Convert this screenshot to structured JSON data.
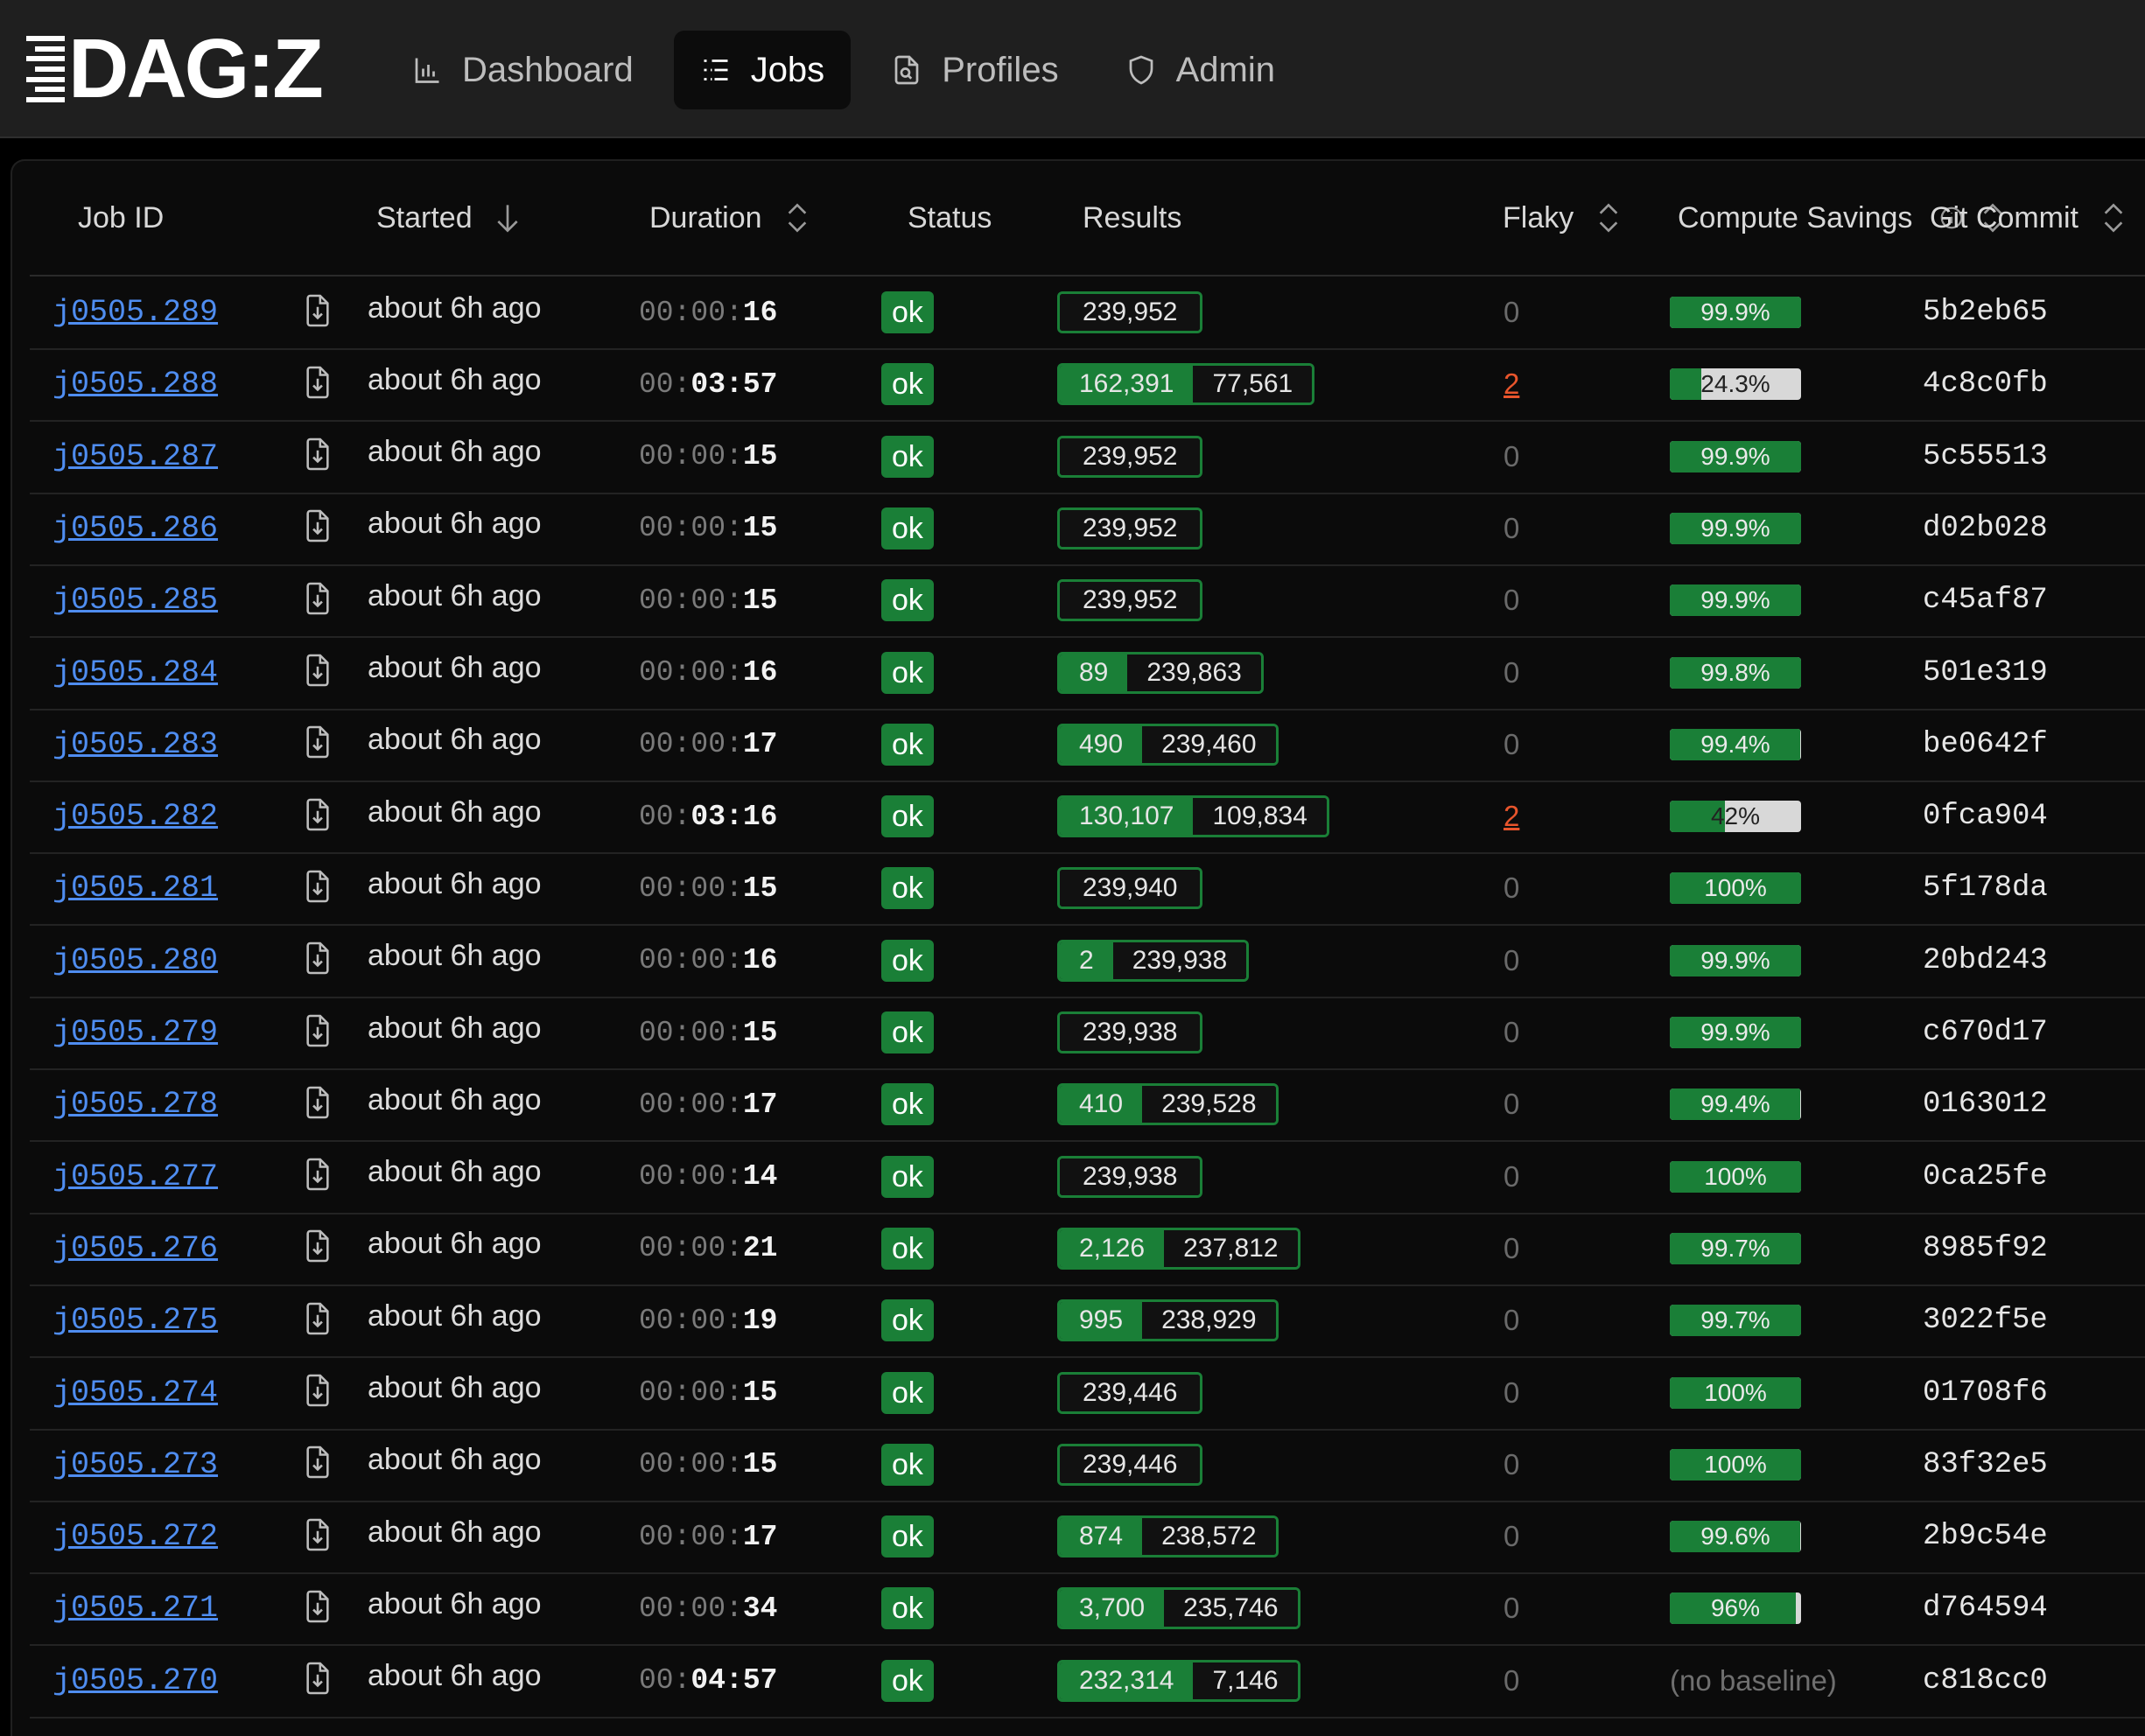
{
  "app": {
    "logo_text": "DAG:Z"
  },
  "nav": [
    {
      "label": "Dashboard",
      "icon": "bar-chart-icon",
      "active": false
    },
    {
      "label": "Jobs",
      "icon": "list-icon",
      "active": true
    },
    {
      "label": "Profiles",
      "icon": "file-search-icon",
      "active": false
    },
    {
      "label": "Admin",
      "icon": "shield-icon",
      "active": false
    }
  ],
  "table": {
    "columns": {
      "job_id": "Job ID",
      "started": "Started",
      "duration": "Duration",
      "status": "Status",
      "results": "Results",
      "flaky": "Flaky",
      "compute_savings_line1": "Compute",
      "compute_savings_line2": "Savings",
      "git_commit": "Git Commit"
    },
    "colors": {
      "ok_green": "#1a7f37",
      "link_blue": "#4f8df0",
      "flaky_orange": "#e8552c"
    },
    "rows": [
      {
        "id": "j0505.289",
        "started": "about 6h ago",
        "dur_prefix": "00:00:",
        "dur_main": "16",
        "status": "ok",
        "results": [
          "239,952"
        ],
        "results_mode": "dark",
        "flaky": "0",
        "savings": "99.9%",
        "savings_pct": 99.9,
        "commit": "5b2eb65"
      },
      {
        "id": "j0505.288",
        "started": "about 6h ago",
        "dur_prefix": "00:",
        "dur_main": "03:57",
        "status": "ok",
        "results": [
          "162,391",
          "77,561"
        ],
        "results_mode": "split",
        "flaky": "2",
        "savings": "24.3%",
        "savings_pct": 24.3,
        "commit": "4c8c0fb"
      },
      {
        "id": "j0505.287",
        "started": "about 6h ago",
        "dur_prefix": "00:00:",
        "dur_main": "15",
        "status": "ok",
        "results": [
          "239,952"
        ],
        "results_mode": "dark",
        "flaky": "0",
        "savings": "99.9%",
        "savings_pct": 99.9,
        "commit": "5c55513"
      },
      {
        "id": "j0505.286",
        "started": "about 6h ago",
        "dur_prefix": "00:00:",
        "dur_main": "15",
        "status": "ok",
        "results": [
          "239,952"
        ],
        "results_mode": "dark",
        "flaky": "0",
        "savings": "99.9%",
        "savings_pct": 99.9,
        "commit": "d02b028"
      },
      {
        "id": "j0505.285",
        "started": "about 6h ago",
        "dur_prefix": "00:00:",
        "dur_main": "15",
        "status": "ok",
        "results": [
          "239,952"
        ],
        "results_mode": "dark",
        "flaky": "0",
        "savings": "99.9%",
        "savings_pct": 99.9,
        "commit": "c45af87"
      },
      {
        "id": "j0505.284",
        "started": "about 6h ago",
        "dur_prefix": "00:00:",
        "dur_main": "16",
        "status": "ok",
        "results": [
          "89",
          "239,863"
        ],
        "results_mode": "split",
        "flaky": "0",
        "savings": "99.8%",
        "savings_pct": 99.8,
        "commit": "501e319"
      },
      {
        "id": "j0505.283",
        "started": "about 6h ago",
        "dur_prefix": "00:00:",
        "dur_main": "17",
        "status": "ok",
        "results": [
          "490",
          "239,460"
        ],
        "results_mode": "split",
        "flaky": "0",
        "savings": "99.4%",
        "savings_pct": 99.4,
        "commit": "be0642f"
      },
      {
        "id": "j0505.282",
        "started": "about 6h ago",
        "dur_prefix": "00:",
        "dur_main": "03:16",
        "status": "ok",
        "results": [
          "130,107",
          "109,834"
        ],
        "results_mode": "split",
        "flaky": "2",
        "savings": "42%",
        "savings_pct": 42,
        "commit": "0fca904"
      },
      {
        "id": "j0505.281",
        "started": "about 6h ago",
        "dur_prefix": "00:00:",
        "dur_main": "15",
        "status": "ok",
        "results": [
          "239,940"
        ],
        "results_mode": "dark",
        "flaky": "0",
        "savings": "100%",
        "savings_pct": 100,
        "commit": "5f178da"
      },
      {
        "id": "j0505.280",
        "started": "about 6h ago",
        "dur_prefix": "00:00:",
        "dur_main": "16",
        "status": "ok",
        "results": [
          "2",
          "239,938"
        ],
        "results_mode": "split",
        "flaky": "0",
        "savings": "99.9%",
        "savings_pct": 99.9,
        "commit": "20bd243"
      },
      {
        "id": "j0505.279",
        "started": "about 6h ago",
        "dur_prefix": "00:00:",
        "dur_main": "15",
        "status": "ok",
        "results": [
          "239,938"
        ],
        "results_mode": "dark",
        "flaky": "0",
        "savings": "99.9%",
        "savings_pct": 99.9,
        "commit": "c670d17"
      },
      {
        "id": "j0505.278",
        "started": "about 6h ago",
        "dur_prefix": "00:00:",
        "dur_main": "17",
        "status": "ok",
        "results": [
          "410",
          "239,528"
        ],
        "results_mode": "split",
        "flaky": "0",
        "savings": "99.4%",
        "savings_pct": 99.4,
        "commit": "0163012"
      },
      {
        "id": "j0505.277",
        "started": "about 6h ago",
        "dur_prefix": "00:00:",
        "dur_main": "14",
        "status": "ok",
        "results": [
          "239,938"
        ],
        "results_mode": "dark",
        "flaky": "0",
        "savings": "100%",
        "savings_pct": 100,
        "commit": "0ca25fe"
      },
      {
        "id": "j0505.276",
        "started": "about 6h ago",
        "dur_prefix": "00:00:",
        "dur_main": "21",
        "status": "ok",
        "results": [
          "2,126",
          "237,812"
        ],
        "results_mode": "split",
        "flaky": "0",
        "savings": "99.7%",
        "savings_pct": 99.7,
        "commit": "8985f92"
      },
      {
        "id": "j0505.275",
        "started": "about 6h ago",
        "dur_prefix": "00:00:",
        "dur_main": "19",
        "status": "ok",
        "results": [
          "995",
          "238,929"
        ],
        "results_mode": "split",
        "flaky": "0",
        "savings": "99.7%",
        "savings_pct": 99.7,
        "commit": "3022f5e"
      },
      {
        "id": "j0505.274",
        "started": "about 6h ago",
        "dur_prefix": "00:00:",
        "dur_main": "15",
        "status": "ok",
        "results": [
          "239,446"
        ],
        "results_mode": "dark",
        "flaky": "0",
        "savings": "100%",
        "savings_pct": 100,
        "commit": "01708f6"
      },
      {
        "id": "j0505.273",
        "started": "about 6h ago",
        "dur_prefix": "00:00:",
        "dur_main": "15",
        "status": "ok",
        "results": [
          "239,446"
        ],
        "results_mode": "dark",
        "flaky": "0",
        "savings": "100%",
        "savings_pct": 100,
        "commit": "83f32e5"
      },
      {
        "id": "j0505.272",
        "started": "about 6h ago",
        "dur_prefix": "00:00:",
        "dur_main": "17",
        "status": "ok",
        "results": [
          "874",
          "238,572"
        ],
        "results_mode": "split",
        "flaky": "0",
        "savings": "99.6%",
        "savings_pct": 99.6,
        "commit": "2b9c54e"
      },
      {
        "id": "j0505.271",
        "started": "about 6h ago",
        "dur_prefix": "00:00:",
        "dur_main": "34",
        "status": "ok",
        "results": [
          "3,700",
          "235,746"
        ],
        "results_mode": "split",
        "flaky": "0",
        "savings": "96%",
        "savings_pct": 96,
        "commit": "d764594"
      },
      {
        "id": "j0505.270",
        "started": "about 6h ago",
        "dur_prefix": "00:",
        "dur_main": "04:57",
        "status": "ok",
        "results": [
          "232,314",
          "7,146"
        ],
        "results_mode": "split",
        "flaky": "0",
        "savings": "(no baseline)",
        "savings_pct": null,
        "commit": "c818cc0"
      }
    ]
  }
}
